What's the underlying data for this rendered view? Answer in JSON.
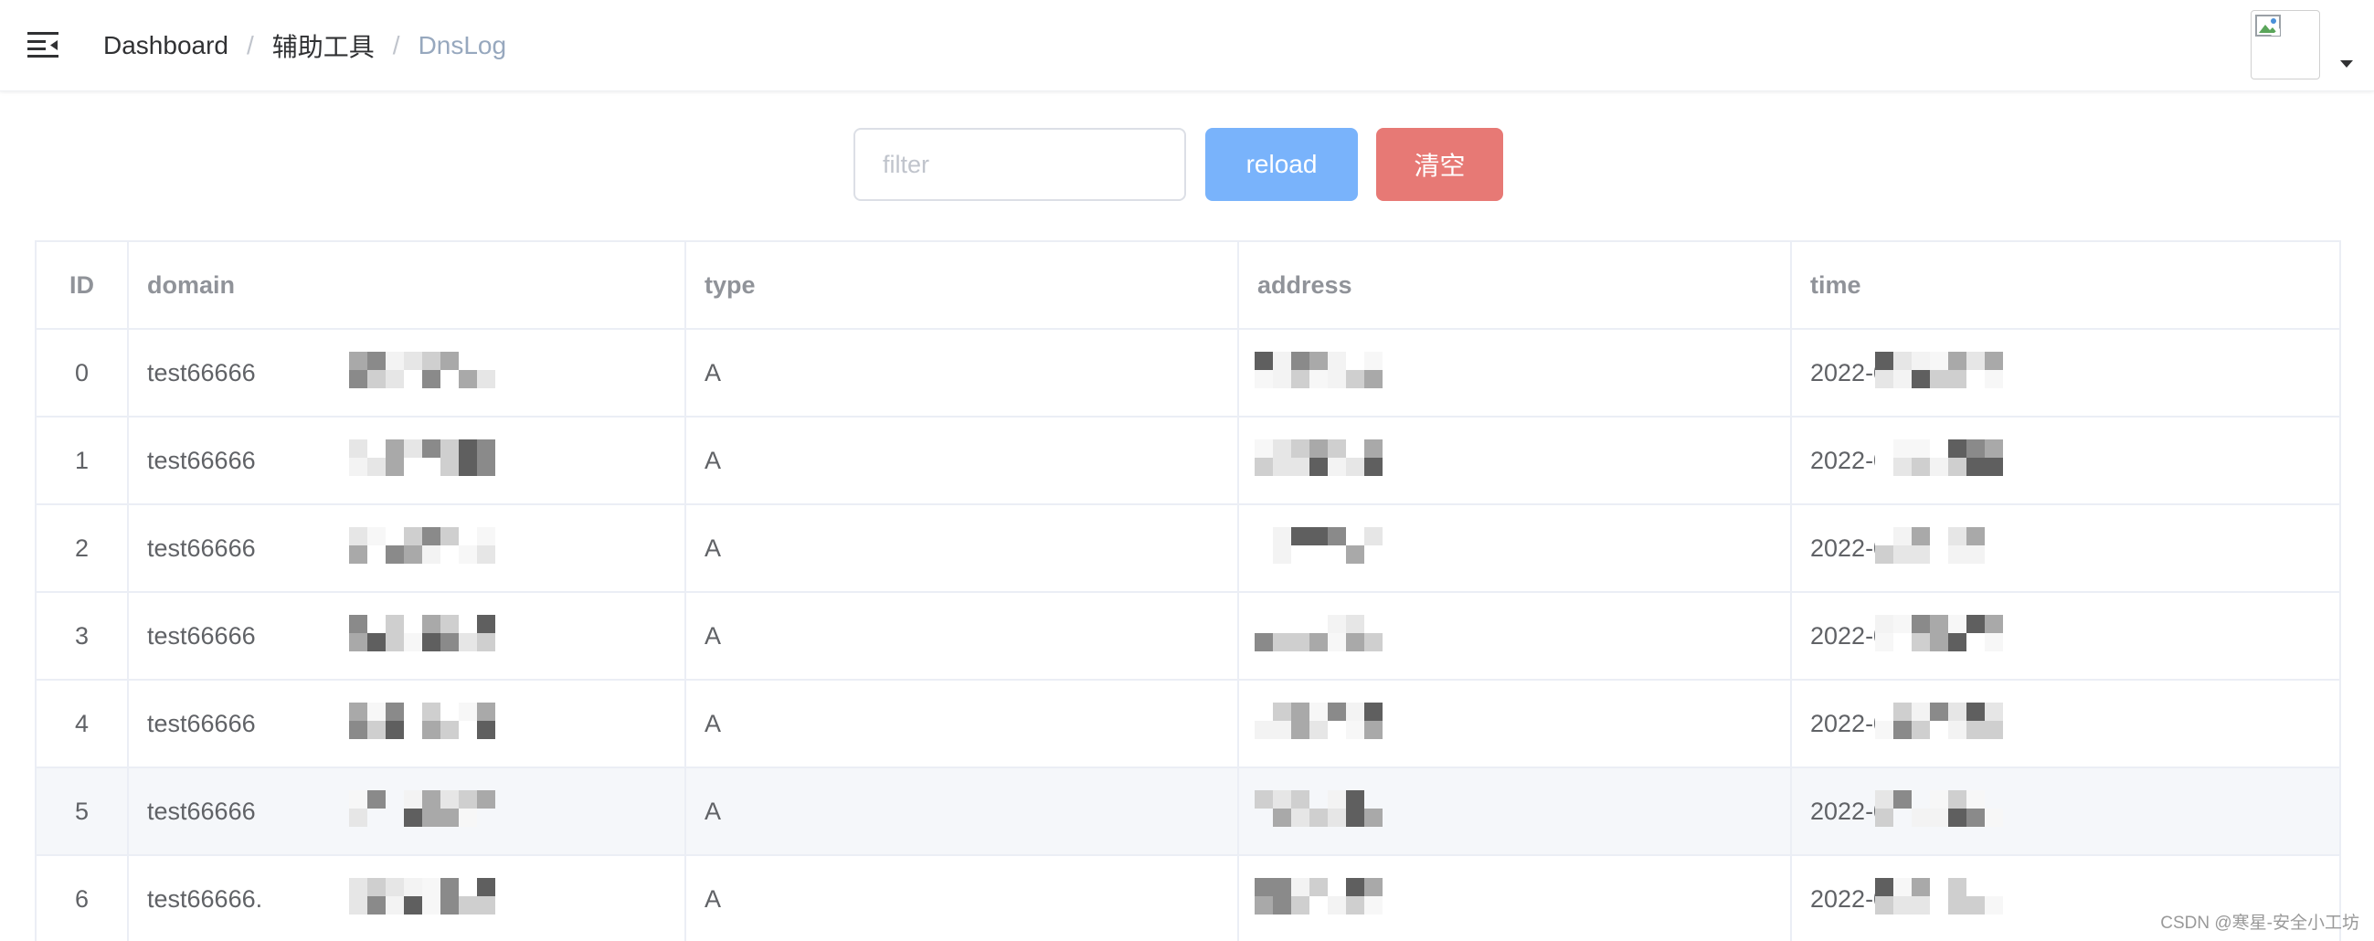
{
  "navbar": {
    "menu_icon": "hamburger-fold-icon",
    "breadcrumb": [
      "Dashboard",
      "辅助工具",
      "DnsLog"
    ],
    "separator": "/",
    "avatar_icon": "broken-image-icon",
    "dropdown_icon": "caret-down-icon"
  },
  "toolbar": {
    "filter_placeholder": "filter",
    "filter_value": "",
    "reload_label": "reload",
    "clear_label": "清空"
  },
  "colors": {
    "reload_button": "#79b3fb",
    "clear_button": "#e77975",
    "breadcrumb_active": "#97a8be",
    "row_hover": "#f5f7fa"
  },
  "table": {
    "columns": [
      "ID",
      "domain",
      "type",
      "address",
      "time"
    ],
    "rows": [
      {
        "id": "0",
        "domain": "test66666",
        "type": "A",
        "address": "",
        "time": "2022-03"
      },
      {
        "id": "1",
        "domain": "test66666",
        "type": "A",
        "address": "",
        "time": "2022-03"
      },
      {
        "id": "2",
        "domain": "test66666",
        "type": "A",
        "address": "",
        "time": "2022-03"
      },
      {
        "id": "3",
        "domain": "test66666",
        "type": "A",
        "address": "",
        "time": "2022-03"
      },
      {
        "id": "4",
        "domain": "test66666",
        "type": "A",
        "address": "",
        "time": "2022-03"
      },
      {
        "id": "5",
        "domain": "test66666",
        "type": "A",
        "address": "",
        "time": "2022-03"
      },
      {
        "id": "6",
        "domain": "test66666.",
        "type": "A",
        "address": "",
        "time": "2022-03"
      }
    ],
    "highlighted_row": 5
  },
  "watermark": "CSDN @寒星-安全小工坊"
}
